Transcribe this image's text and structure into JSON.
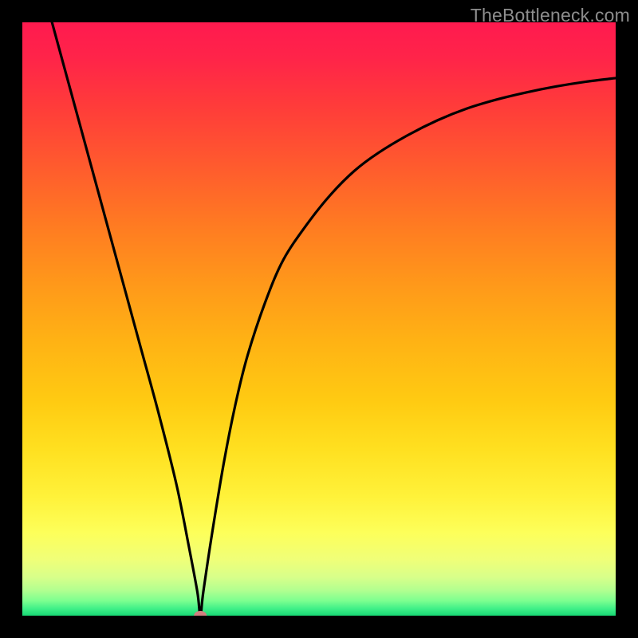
{
  "watermark": "TheBottleneck.com",
  "chart_data": {
    "type": "line",
    "title": "",
    "xlabel": "",
    "ylabel": "",
    "xlim": [
      0,
      100
    ],
    "ylim": [
      0,
      100
    ],
    "grid": false,
    "legend": false,
    "notch_x": 30,
    "marker": {
      "x": 30,
      "y": 0,
      "color": "#d18080"
    },
    "background_gradient": [
      {
        "stop": 0.0,
        "color": "#ff1a4f"
      },
      {
        "stop": 0.06,
        "color": "#ff2449"
      },
      {
        "stop": 0.14,
        "color": "#ff3b3a"
      },
      {
        "stop": 0.24,
        "color": "#ff5a2e"
      },
      {
        "stop": 0.34,
        "color": "#ff7a22"
      },
      {
        "stop": 0.44,
        "color": "#ff981a"
      },
      {
        "stop": 0.54,
        "color": "#ffb314"
      },
      {
        "stop": 0.64,
        "color": "#ffcb12"
      },
      {
        "stop": 0.72,
        "color": "#ffe020"
      },
      {
        "stop": 0.8,
        "color": "#fff23a"
      },
      {
        "stop": 0.86,
        "color": "#fdff5a"
      },
      {
        "stop": 0.905,
        "color": "#f0ff78"
      },
      {
        "stop": 0.935,
        "color": "#d8ff8a"
      },
      {
        "stop": 0.958,
        "color": "#b0ff90"
      },
      {
        "stop": 0.975,
        "color": "#7cff90"
      },
      {
        "stop": 0.988,
        "color": "#40f088"
      },
      {
        "stop": 1.0,
        "color": "#18d874"
      }
    ],
    "series": [
      {
        "name": "curve",
        "color": "#000000",
        "x": [
          5,
          8,
          11,
          14,
          17,
          20,
          23,
          26,
          28,
          29.5,
          30,
          30.5,
          32,
          34,
          36,
          38,
          41,
          44,
          48,
          52,
          56,
          60,
          65,
          70,
          75,
          80,
          85,
          90,
          95,
          100
        ],
        "y": [
          100,
          89,
          78,
          67,
          56,
          45,
          34,
          22,
          12,
          4,
          0,
          4,
          14,
          26,
          36,
          44,
          53,
          60,
          66,
          71,
          75,
          78,
          81,
          83.5,
          85.5,
          87,
          88.2,
          89.2,
          90,
          90.6
        ]
      }
    ]
  }
}
